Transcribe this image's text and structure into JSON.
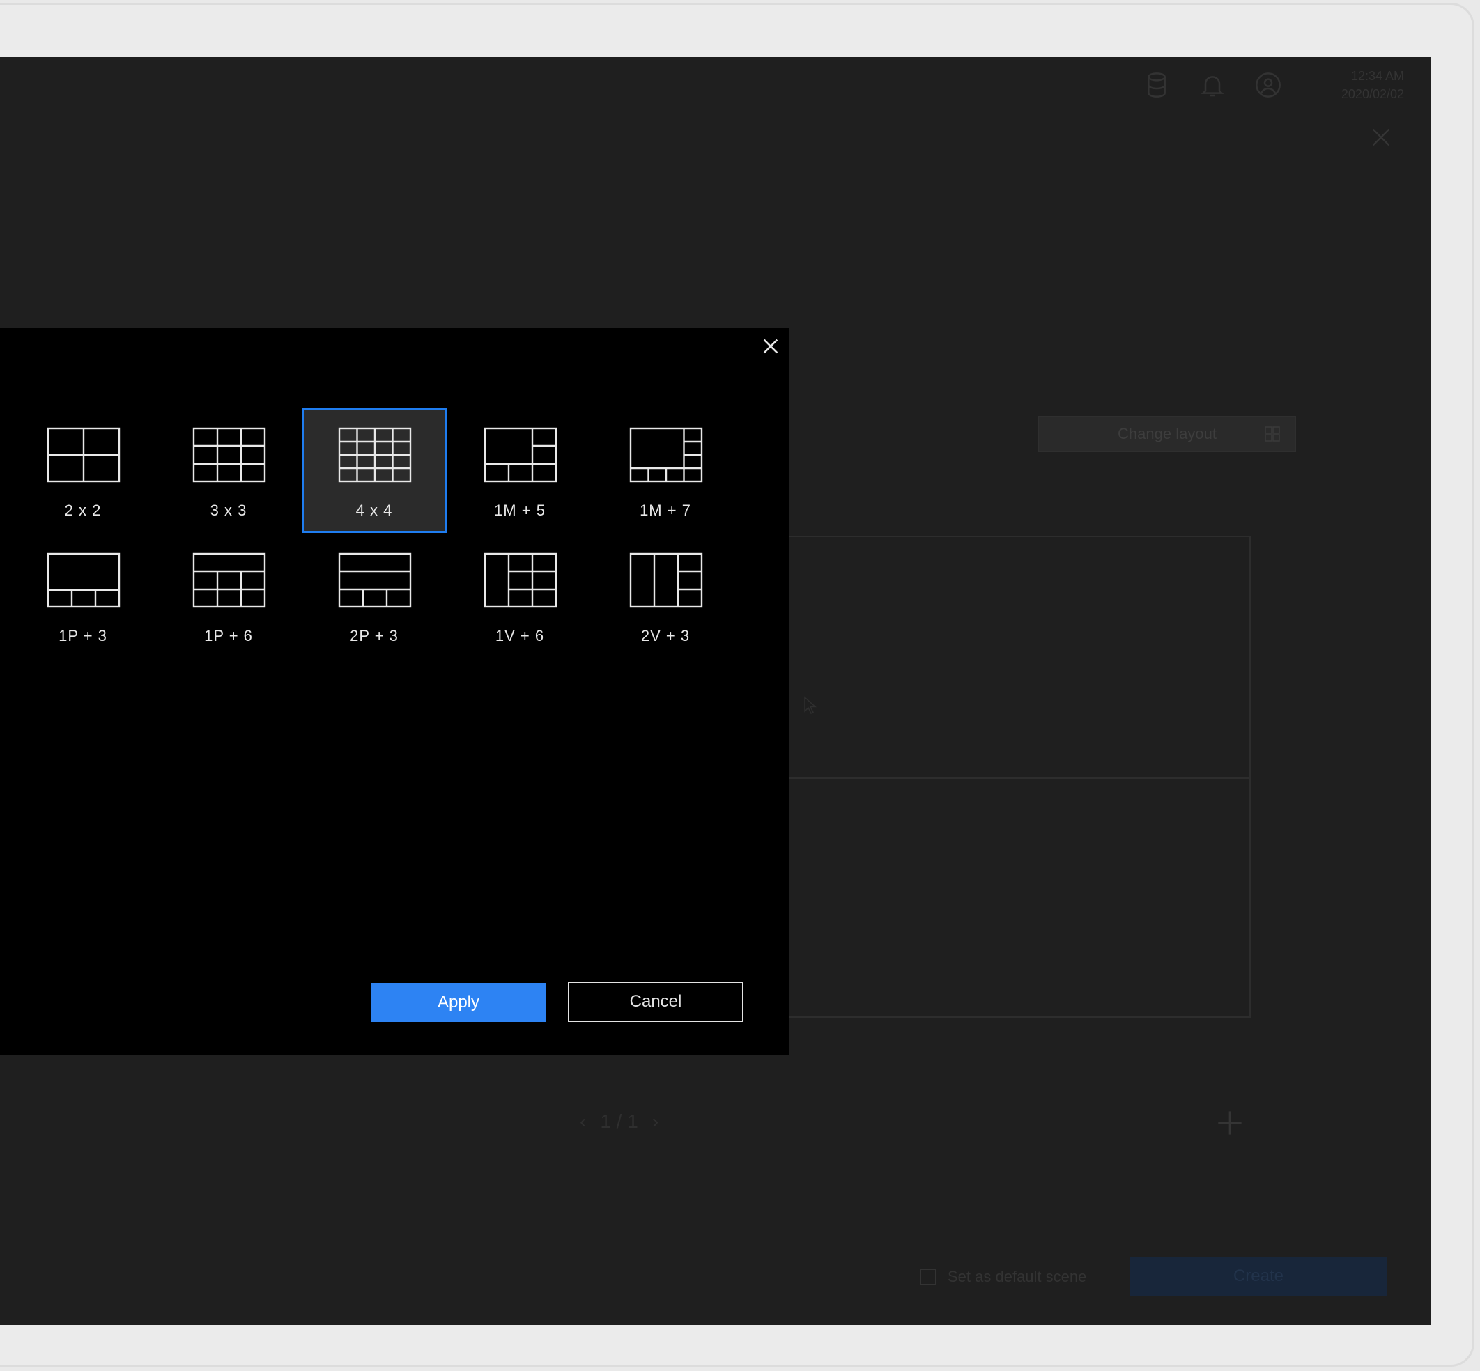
{
  "status_bar": {
    "time": "12:34 AM",
    "date": "2020/02/02",
    "icons": [
      "database-icon",
      "bell-icon",
      "user-circle-icon"
    ]
  },
  "background_panel": {
    "change_layout_label": "Change layout",
    "pager_prev": "‹",
    "pager_text": "1 / 1",
    "pager_next": "›",
    "default_scene_label": "Set as default scene",
    "create_label": "Create"
  },
  "layout_dialog": {
    "layouts": [
      {
        "id": "2x2",
        "label": "2 x 2",
        "selected": false
      },
      {
        "id": "3x3",
        "label": "3 x 3",
        "selected": false
      },
      {
        "id": "4x4",
        "label": "4 x 4",
        "selected": true
      },
      {
        "id": "1m5",
        "label": "1M + 5",
        "selected": false
      },
      {
        "id": "1m7",
        "label": "1M + 7",
        "selected": false
      },
      {
        "id": "1p3",
        "label": "1P + 3",
        "selected": false
      },
      {
        "id": "1p6",
        "label": "1P + 6",
        "selected": false
      },
      {
        "id": "2p3",
        "label": "2P + 3",
        "selected": false
      },
      {
        "id": "1v6",
        "label": "1V + 6",
        "selected": false
      },
      {
        "id": "2v3",
        "label": "2V + 3",
        "selected": false
      }
    ],
    "apply_label": "Apply",
    "cancel_label": "Cancel"
  },
  "colors": {
    "accent": "#2d83f3",
    "selection_border": "#1f7df0",
    "dialog_bg": "#000000",
    "screen_bg": "#1f1f1f"
  }
}
